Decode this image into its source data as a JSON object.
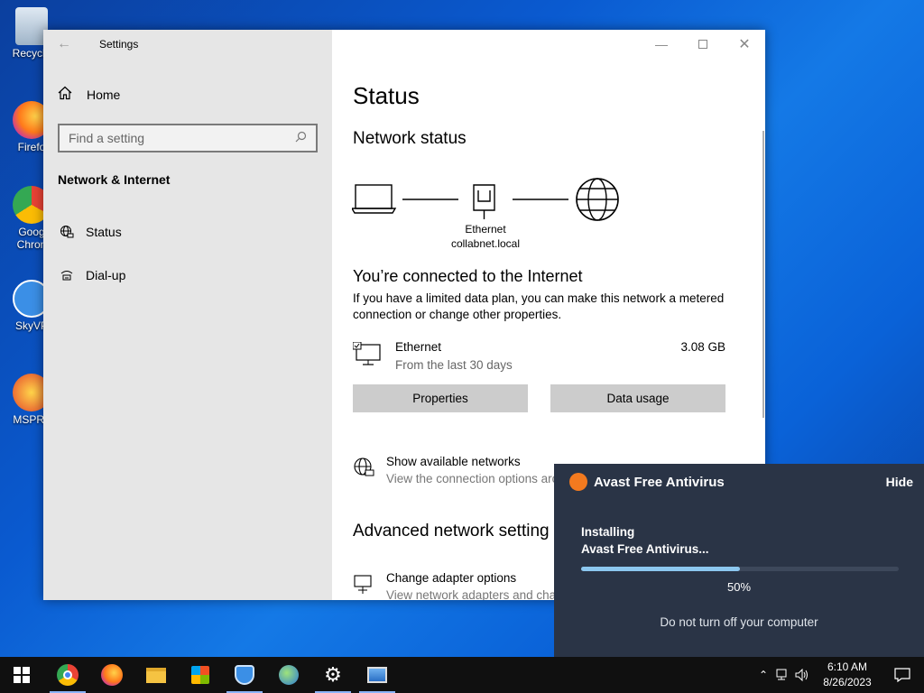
{
  "desktop": {
    "icons": [
      {
        "label": "Recycle"
      },
      {
        "label": "Firefo"
      },
      {
        "label": "Goog Chron"
      },
      {
        "label": "SkyVP"
      },
      {
        "label": "MSPRe"
      }
    ]
  },
  "window": {
    "title": "Settings",
    "back_icon": "arrow-left-icon",
    "controls": [
      "minimize-icon",
      "maximize-icon",
      "close-icon"
    ]
  },
  "sidebar": {
    "home_label": "Home",
    "search_placeholder": "Find a setting",
    "section": "Network & Internet",
    "items": [
      {
        "label": "Status",
        "icon": "globe-network-icon"
      },
      {
        "label": "Dial-up",
        "icon": "dialup-icon"
      }
    ]
  },
  "main": {
    "heading": "Status",
    "network_status": "Network status",
    "adapter_name": "Ethernet",
    "adapter_domain": "collabnet.local",
    "connected": "You’re connected to the Internet",
    "description": "If you have a limited data plan, you can make this network a metered connection or change other properties.",
    "ethernet": {
      "name": "Ethernet",
      "sub": "From the last 30 days",
      "usage": "3.08 GB"
    },
    "buttons": {
      "properties": "Properties",
      "data_usage": "Data usage"
    },
    "show_networks": {
      "title": "Show available networks",
      "sub": "View the connection options aro"
    },
    "advanced": "Advanced network setting",
    "change_adapter": {
      "title": "Change adapter options",
      "sub": "View network adapters and chan"
    }
  },
  "avast": {
    "title": "Avast Free Antivirus",
    "hide": "Hide",
    "line1": "Installing",
    "line2": "Avast Free Antivirus...",
    "progress": 0.5,
    "percent": "50%",
    "warning": "Do not turn off your computer",
    "accent": "#f37a1f"
  },
  "taskbar": {
    "apps": [
      "windows-start-icon",
      "chrome-icon",
      "firefox-icon",
      "file-explorer-icon",
      "store-icon",
      "vpn-shield-icon",
      "network-globe-icon",
      "settings-gear-icon",
      "control-panel-icon"
    ],
    "time": "6:10 AM",
    "date": "8/26/2023"
  }
}
